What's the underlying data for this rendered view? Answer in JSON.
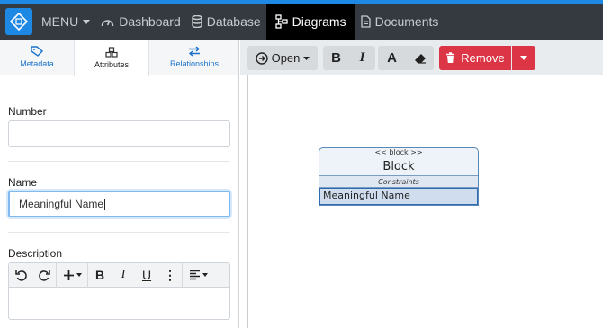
{
  "nav": {
    "menu": "MENU",
    "dashboard": "Dashboard",
    "database": "Database",
    "diagrams": "Diagrams",
    "documents": "Documents"
  },
  "tabs": {
    "metadata": "Metadata",
    "attributes": "Attributes",
    "relationships": "Relationships"
  },
  "form": {
    "number_label": "Number",
    "number_value": "",
    "name_label": "Name",
    "name_value": "Meaningful Name",
    "description_label": "Description"
  },
  "toolbar": {
    "open": "Open",
    "bold": "B",
    "italic": "I",
    "text": "A",
    "remove": "Remove"
  },
  "rte": {
    "bold": "B",
    "italic": "I",
    "underline": "U",
    "more": "⋮"
  },
  "block": {
    "stereotype": "<< block >>",
    "name": "Block",
    "section": "Constraints",
    "property": "Meaningful Name"
  },
  "colors": {
    "accent": "#1e88e5",
    "navbar": "#343a40",
    "remove": "#dc3545"
  }
}
